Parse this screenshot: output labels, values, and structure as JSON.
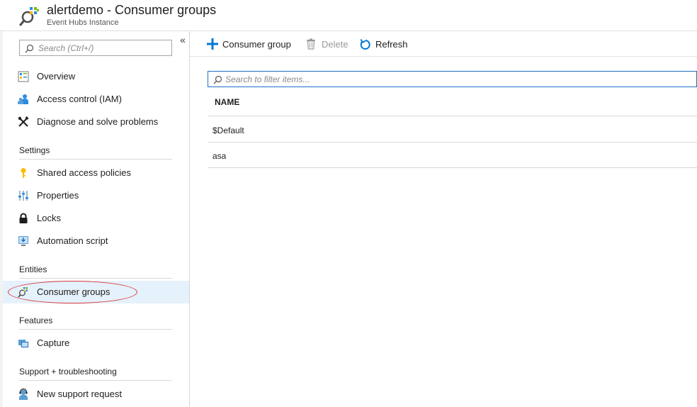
{
  "header": {
    "title": "alertdemo - Consumer groups",
    "subtitle": "Event Hubs Instance",
    "icon": "consumer-groups-icon"
  },
  "sidebar": {
    "collapse_glyph": "«",
    "search_placeholder": "Search (Ctrl+/)",
    "items_top": [
      {
        "label": "Overview",
        "icon": "overview-icon"
      },
      {
        "label": "Access control (IAM)",
        "icon": "iam-icon"
      },
      {
        "label": "Diagnose and solve problems",
        "icon": "wrench-icon"
      }
    ],
    "settings": {
      "heading": "Settings",
      "items": [
        {
          "label": "Shared access policies",
          "icon": "key-icon"
        },
        {
          "label": "Properties",
          "icon": "properties-icon"
        },
        {
          "label": "Locks",
          "icon": "lock-icon"
        },
        {
          "label": "Automation script",
          "icon": "automation-icon"
        }
      ]
    },
    "entities": {
      "heading": "Entities",
      "items": [
        {
          "label": "Consumer groups",
          "icon": "consumer-groups-icon",
          "active": true
        }
      ]
    },
    "features": {
      "heading": "Features",
      "items": [
        {
          "label": "Capture",
          "icon": "capture-icon"
        }
      ]
    },
    "support": {
      "heading": "Support + troubleshooting",
      "items": [
        {
          "label": "New support request",
          "icon": "support-icon"
        }
      ]
    }
  },
  "toolbar": {
    "add_label": "Consumer group",
    "delete_label": "Delete",
    "refresh_label": "Refresh"
  },
  "main": {
    "filter_placeholder": "Search to filter items...",
    "columns": [
      "NAME"
    ],
    "rows": [
      "$Default",
      "asa"
    ]
  },
  "colors": {
    "accent": "#0078d4",
    "active_bg": "#e5f1fb",
    "annotation": "#d9383a"
  }
}
